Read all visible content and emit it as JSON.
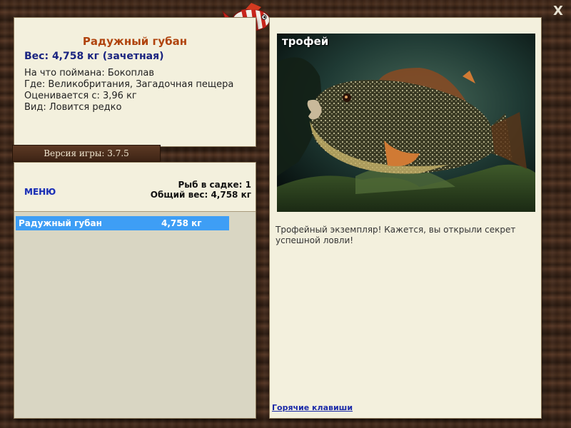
{
  "fish": {
    "name": "Радужный губан",
    "weight_line": "Вес: 4,758 кг (зачетная)",
    "bait_line": "На что поймана: Бокоплав",
    "location_line": "Где: Великобритания, Загадочная пещера",
    "value_line": "Оценивается с: 3,96 кг",
    "rarity_line": "Вид: Ловится редко"
  },
  "version_label": "Версия игры: 3.7.5",
  "cage": {
    "menu_label": "МЕНЮ",
    "count_line": "Рыб в садке: 1",
    "total_line": "Общий вес: 4,758 кг",
    "items": [
      {
        "name": "Радужный губан",
        "weight": "4,758 кг"
      }
    ]
  },
  "detail": {
    "photo_label": "трофей",
    "description": "Трофейный экземпляр! Кажется, вы открыли секрет успешной ловли!",
    "hotkeys_link": "Горячие клавиши"
  },
  "close_symbol": "X",
  "icons": {
    "close": "close-icon",
    "logo": "fish-logo-icon"
  },
  "colors": {
    "fish_name": "#b0440e",
    "weight": "#1a2480",
    "selection": "#3e9ef5",
    "paper": "#f3f0dd",
    "link": "#1a2aa8"
  }
}
